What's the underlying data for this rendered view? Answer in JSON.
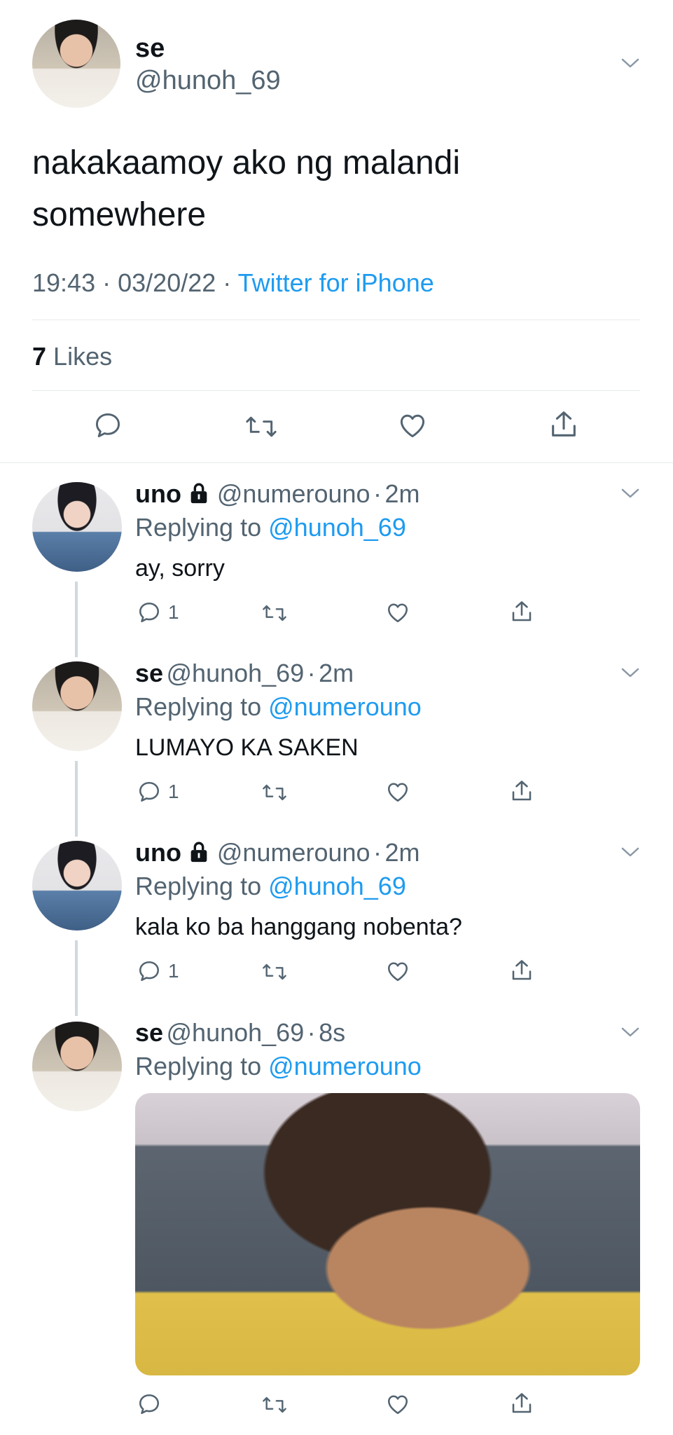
{
  "main_tweet": {
    "display_name": "se",
    "handle": "@hunoh_69",
    "text_line1": "nakakaamoy ako ng malandi",
    "text_line2": "somewhere",
    "time": "19:43",
    "date": "03/20/22",
    "source": "Twitter for iPhone",
    "likes_count": "7",
    "likes_label": "Likes",
    "separator": "·"
  },
  "replies": [
    {
      "display_name": "uno",
      "handle": "@numerouno",
      "time": "2m",
      "replying_label": "Replying to",
      "replying_to": "@hunoh_69",
      "text": "ay, sorry",
      "reply_count": "1"
    },
    {
      "display_name": "se",
      "handle": "@hunoh_69",
      "time": "2m",
      "replying_label": "Replying to",
      "replying_to": "@numerouno",
      "text": "LUMAYO KA SAKEN",
      "reply_count": "1"
    },
    {
      "display_name": "uno",
      "handle": "@numerouno",
      "time": "2m",
      "replying_label": "Replying to",
      "replying_to": "@hunoh_69",
      "text": "kala ko ba hanggang nobenta?",
      "reply_count": "1"
    },
    {
      "display_name": "se",
      "handle": "@hunoh_69",
      "time": "8s",
      "replying_label": "Replying to",
      "replying_to": "@numerouno"
    }
  ],
  "icons": {
    "reply": "reply-icon",
    "retweet": "retweet-icon",
    "like": "heart-icon",
    "share": "share-icon",
    "more": "chevron-down-icon",
    "protected": "lock-icon"
  },
  "colors": {
    "link": "#1d9bf0",
    "secondary_text": "#536471",
    "primary_text": "#0f1419",
    "divider": "#e6e9ec"
  }
}
